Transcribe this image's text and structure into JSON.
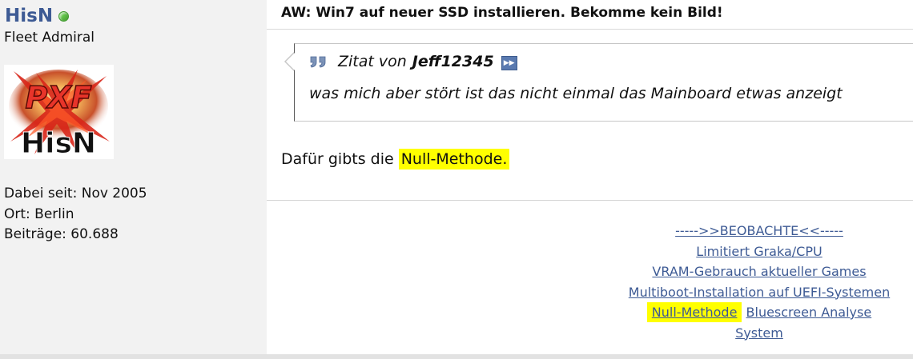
{
  "user": {
    "name": "HisN",
    "online_color": "#5fc447",
    "rank": "Fleet Admiral",
    "avatar_text_top": "PXF",
    "avatar_text_bottom": "HisN",
    "joined": "Dabei seit: Nov 2005",
    "location": "Ort: Berlin",
    "posts": "Beiträge: 60.688"
  },
  "post": {
    "title": "AW: Win7 auf neuer SSD installieren. Bekomme kein Bild!",
    "quote": {
      "icon": "quote-icon",
      "prefix": "Zitat von",
      "author": "Jeff12345",
      "goto_icon": "goto-post-icon",
      "text": "was mich aber stört ist das nicht einmal das Mainboard etwas anzeigt"
    },
    "text_before": "Dafür gibts die ",
    "highlight": "Null-Methode."
  },
  "signature": {
    "link_1": "----->>BEOBACHTE<<-----",
    "link_2": "Limitiert Graka/CPU",
    "link_3": "VRAM-Gebrauch aktueller Games",
    "link_4": "Multiboot-Installation auf UEFI-Systemen",
    "link_5": "Null-Methode",
    "link_6": "Bluescreen Analyse",
    "link_7": "System"
  },
  "colors": {
    "link": "#3d5a94",
    "highlight": "#ffff00",
    "sidebar_bg": "#f2f2f2"
  }
}
